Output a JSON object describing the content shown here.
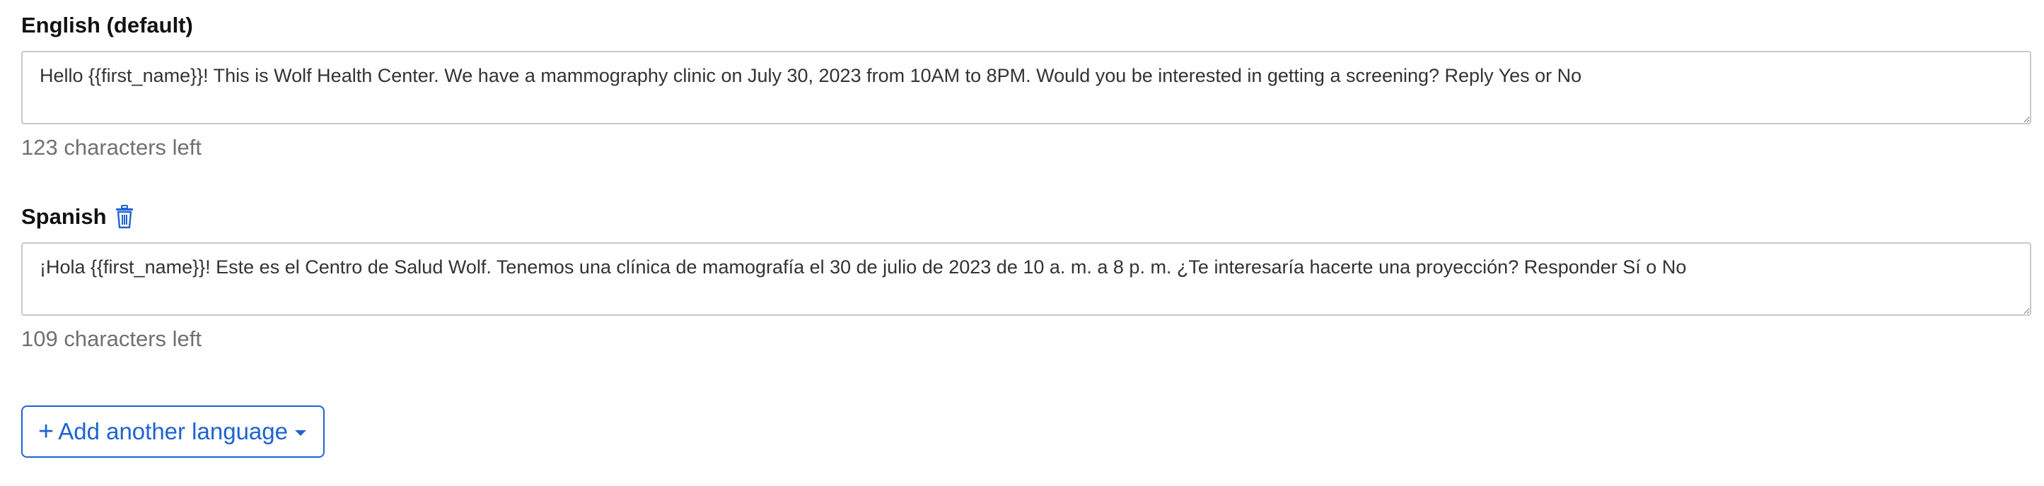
{
  "languages": [
    {
      "label": "English (default)",
      "message": "Hello {{first_name}}! This is Wolf Health Center. We have a mammography clinic on July 30, 2023 from 10AM to 8PM. Would you be interested in getting a screening? Reply Yes or No",
      "chars_left": "123 characters left",
      "deletable": false
    },
    {
      "label": "Spanish",
      "message": "¡Hola {{first_name}}! Este es el Centro de Salud Wolf. Tenemos una clínica de mamografía el 30 de julio de 2023 de 10 a. m. a 8 p. m. ¿Te interesaría hacerte una proyección? Responder Sí o No",
      "chars_left": "109 characters left",
      "deletable": true
    }
  ],
  "add_language": {
    "plus": "+",
    "label": "Add another language"
  },
  "colors": {
    "accent": "#1f63d1",
    "muted_text": "#707070",
    "border": "#c8c8c8"
  },
  "icons": {
    "delete": "trash-icon",
    "add": "plus-icon",
    "dropdown": "caret-down-icon"
  }
}
